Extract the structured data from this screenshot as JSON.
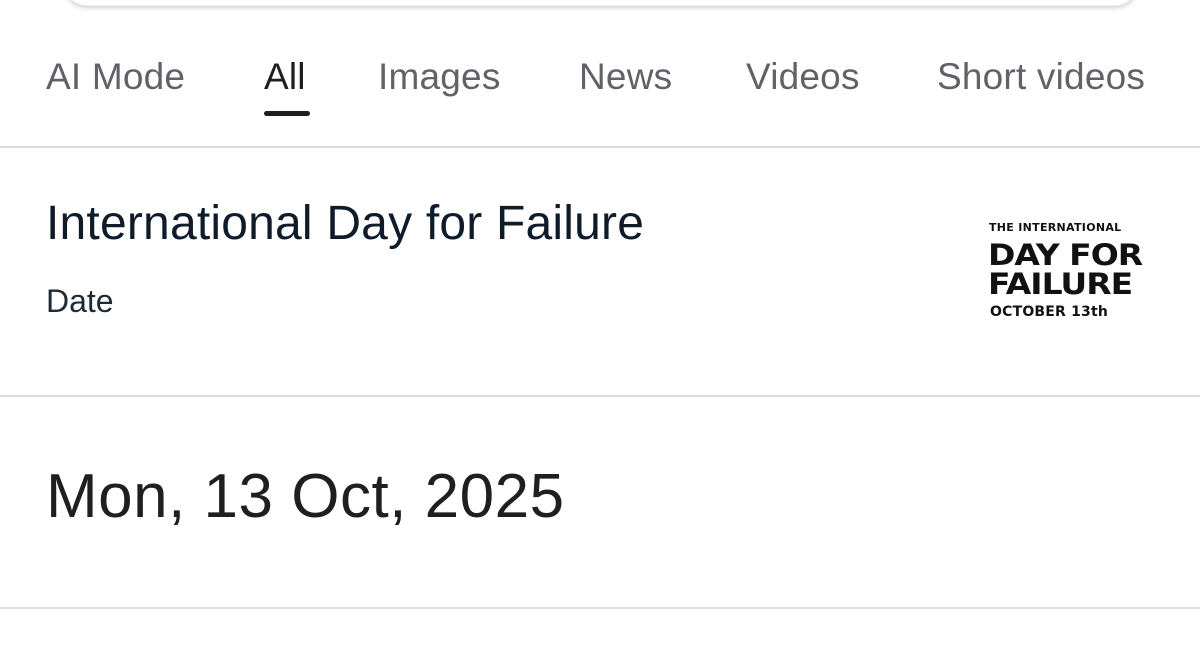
{
  "tabs": [
    {
      "label": "AI Mode",
      "active": false
    },
    {
      "label": "All",
      "active": true
    },
    {
      "label": "Images",
      "active": false
    },
    {
      "label": "News",
      "active": false
    },
    {
      "label": "Videos",
      "active": false
    },
    {
      "label": "Short videos",
      "active": false
    }
  ],
  "result": {
    "title": "International Day for Failure",
    "subtitle": "Date",
    "date": "Mon, 13 Oct, 2025",
    "logo": {
      "line1": "THE INTERNATIONAL",
      "line2": "DAY FOR",
      "line3": "FAILURE",
      "line4": "OCTOBER 13th"
    }
  },
  "colors": {
    "tab_inactive": "#5f6368",
    "tab_active": "#1f1f1f",
    "divider": "#dadce0",
    "title": "#0d1b2a"
  }
}
